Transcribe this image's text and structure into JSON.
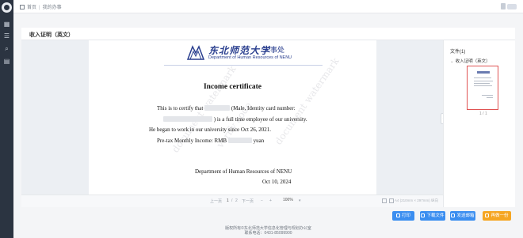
{
  "rail": {
    "icons": [
      "home-icon",
      "list-icon",
      "search-icon",
      "document-icon"
    ]
  },
  "topbar": {
    "breadcrumb_home": "首页",
    "breadcrumb_current": "我的办事"
  },
  "page": {
    "title": "收入证明（英文）"
  },
  "document": {
    "letterhead": {
      "school_cn": "东北师范大学",
      "dept_cn": "人事处",
      "dept_en": "Department of Human Resources of NENU"
    },
    "title": "Income certificate",
    "line1_a": "This is to certify that",
    "line1_b": "(Male, Identity card number:",
    "line2": ") is a full time employee of our university.",
    "line3": "He began to work in our university since Oct 26, 2021.",
    "line4_a": "Pre-tax Monthly Income:  RMB",
    "line4_b": "yuan",
    "signature_dept": "Department of Human Resources of NENU",
    "signature_date": "Oct 10, 2024"
  },
  "doc_toolbar": {
    "prev": "上一页",
    "page_current": "1",
    "page_sep": "/",
    "page_total": "2",
    "next": "下一页",
    "zoom": "100%",
    "size": "A4 (210mm × 297mm) 纵向"
  },
  "file_panel": {
    "title": "文件(1)",
    "item": "收入证明（英文）",
    "page_indicator": "1 / 1"
  },
  "actions": {
    "print": "打印",
    "download": "下载文件",
    "email": "发送邮箱",
    "apply_again": "再做一份"
  },
  "footer": {
    "line1": "版权所有©东北师范大学信息化管理与规划办公室",
    "line2": "联系电话：0431-85099900"
  },
  "colors": {
    "rail": "#2b3441",
    "primary_button": "#3b8ef0",
    "accent_button": "#f5a623",
    "thumb_border": "#e05353",
    "letterhead": "#2a3f8f"
  }
}
